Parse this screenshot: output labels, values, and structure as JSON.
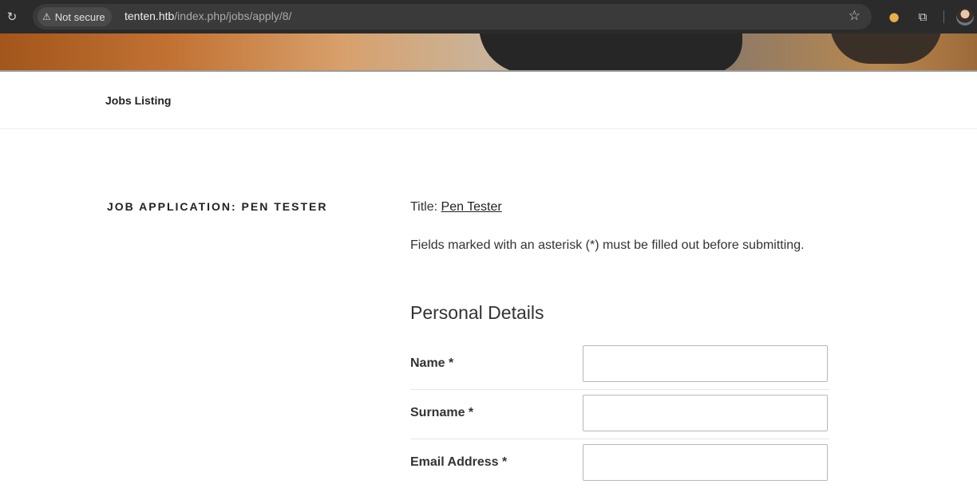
{
  "browser": {
    "security_label": "Not secure",
    "url_host": "tenten.htb",
    "url_path": "/index.php/jobs/apply/8/"
  },
  "nav": {
    "items": [
      {
        "label": "Jobs Listing"
      }
    ]
  },
  "page": {
    "entry_title": "Job Application: Pen Tester",
    "title_prefix": "Title:",
    "title_link": "Pen Tester",
    "help_text": "Fields marked with an asterisk (*) must be filled out before submitting.",
    "section_heading": "Personal Details"
  },
  "form": {
    "fields": [
      {
        "label": "Name *",
        "value": ""
      },
      {
        "label": "Surname *",
        "value": ""
      },
      {
        "label": "Email Address *",
        "value": ""
      }
    ]
  },
  "colors": {
    "chrome_bg": "#2b2b2b",
    "omnibox_bg": "#3a3a3a",
    "text": "#222222",
    "input_border": "#b8b8b8"
  },
  "icons": [
    "reload-icon",
    "warning-icon",
    "bookmark-star-icon",
    "cookie-extension-icon",
    "extensions-puzzle-icon",
    "profile-avatar"
  ]
}
